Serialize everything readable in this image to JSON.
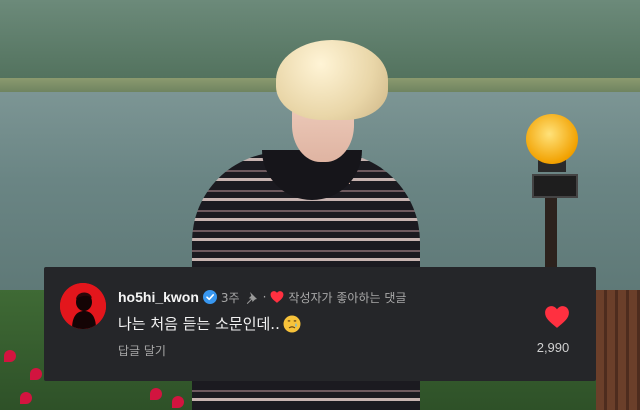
{
  "comment": {
    "username": "ho5hi_kwon",
    "time_ago": "3주",
    "separator": "·",
    "liked_by_author_text": "작성자가 좋아하는 댓글",
    "text": "나는 처음 듣는 소문인데..",
    "emoji": "crying-face-emoji",
    "reply_label": "답글 달기",
    "like_count": "2,990"
  },
  "icons": {
    "verified": "verified-badge-icon",
    "pin": "pin-icon",
    "liked_heart": "heart-icon",
    "like_button": "heart-icon"
  },
  "colors": {
    "card_background": "#252629",
    "heart": "#ff3040",
    "verified": "#3897f0",
    "avatar": "#e3161c",
    "username": "#f5f5f5",
    "secondary_text": "#a8a8a8"
  }
}
